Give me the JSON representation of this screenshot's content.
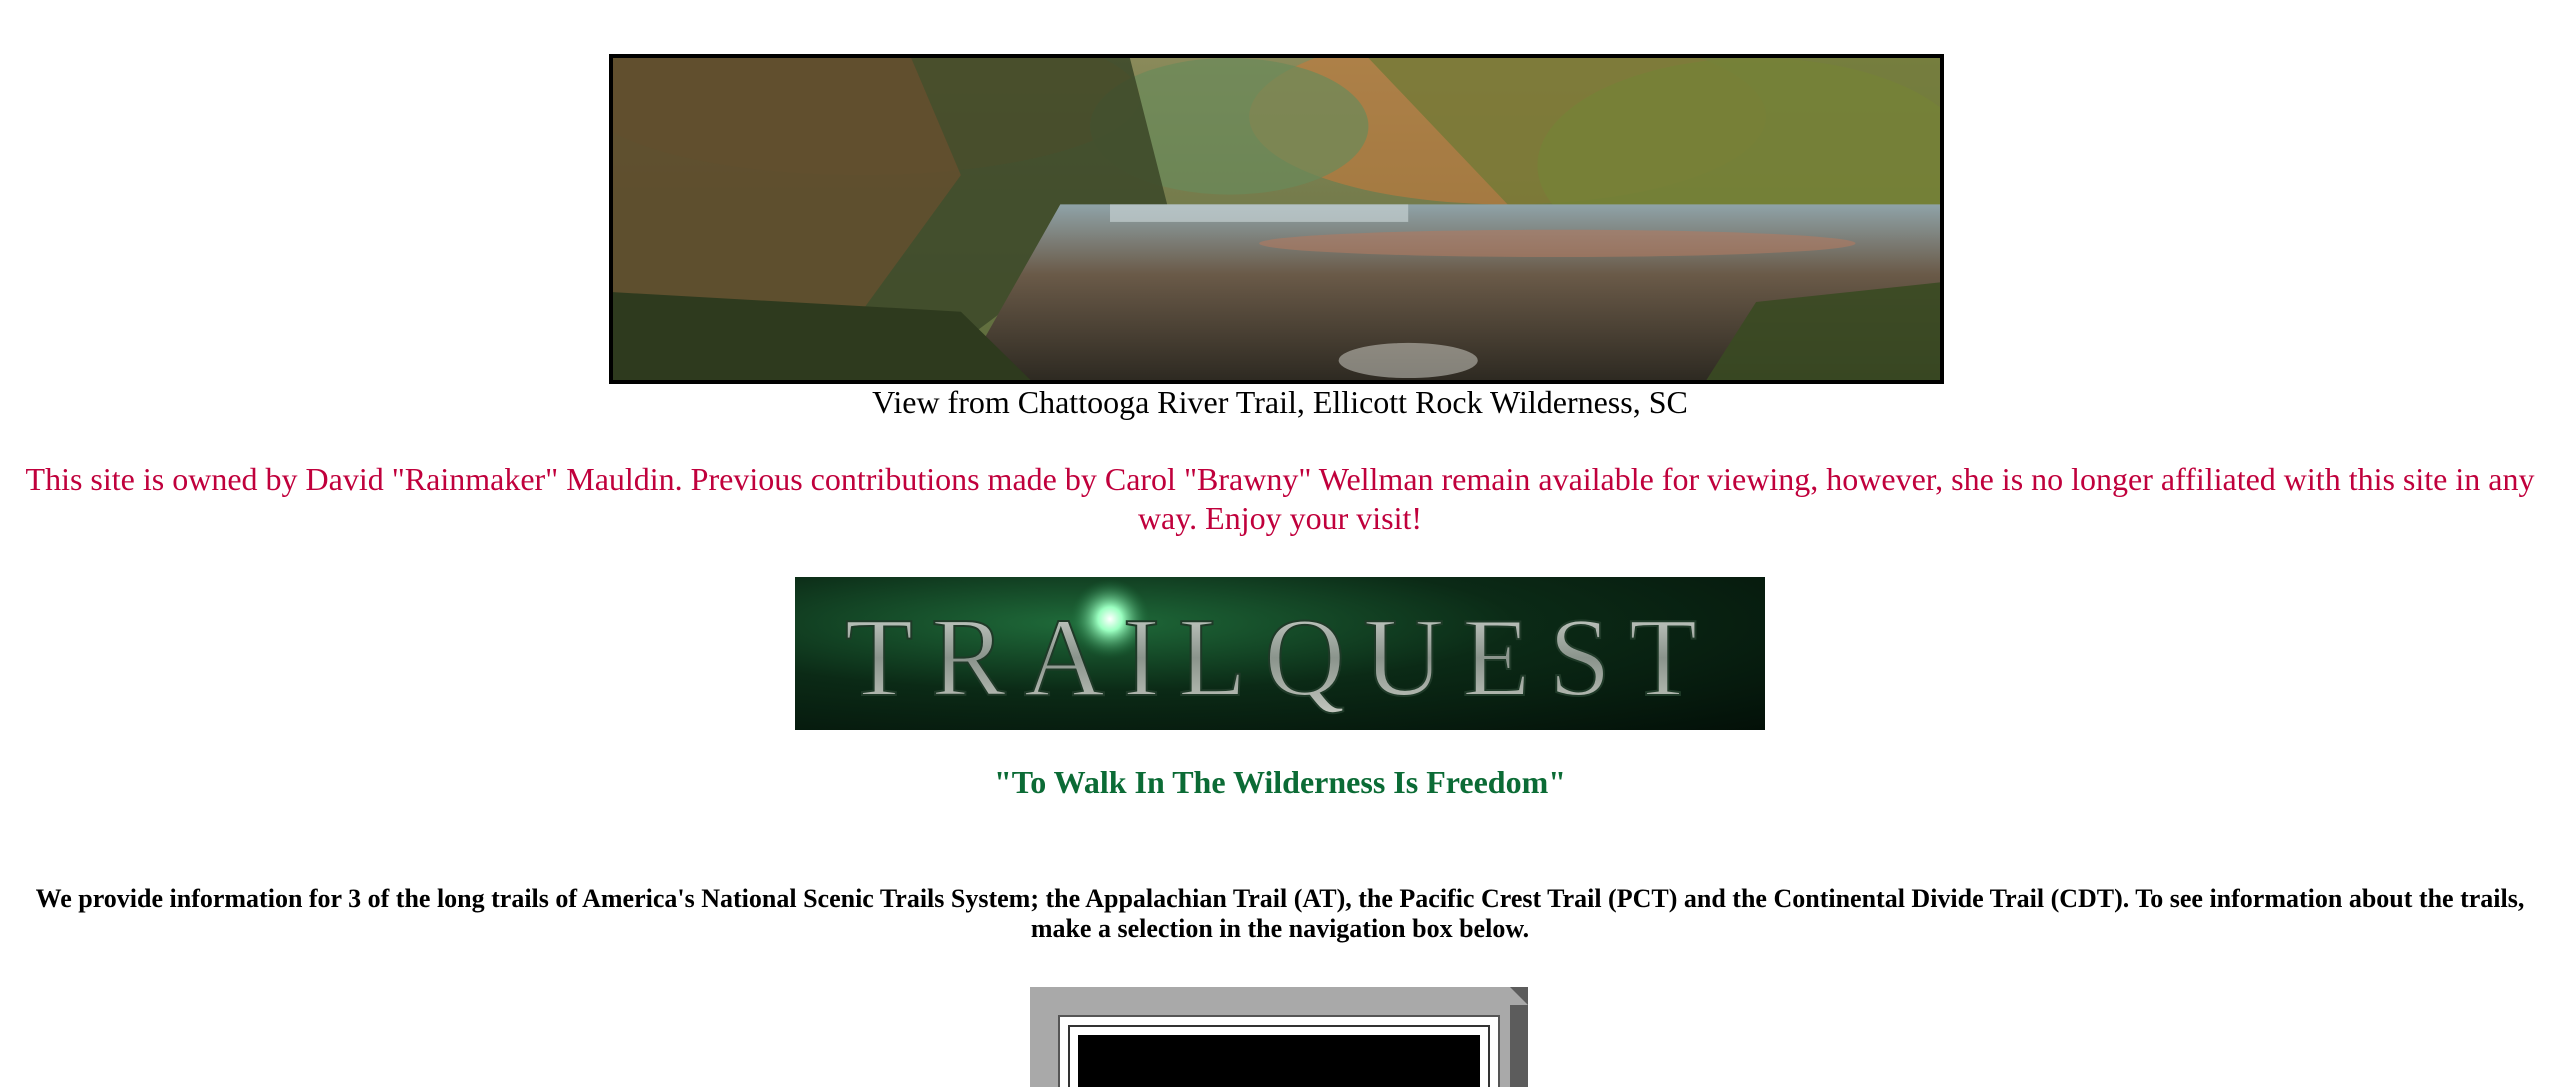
{
  "hero": {
    "caption": "View from Chattooga River Trail, Ellicott Rock Wilderness, SC"
  },
  "notice": {
    "text": "This site is owned by David \"Rainmaker\" Mauldin. Previous contributions made by Carol \"Brawny\" Wellman remain available for viewing, however, she is no longer affiliated with this site in any way. Enjoy your visit!"
  },
  "logo": {
    "text": "TRAILQUEST"
  },
  "motto": "\"To Walk In The Wilderness Is Freedom\"",
  "intro": "We provide information for 3 of the long trails of America's National Scenic Trails System; the Appalachian Trail (AT), the Pacific Crest Trail (PCT) and the Continental Divide Trail (CDT). To see information about the trails, make a selection in the navigation box below.",
  "colors": {
    "notice": "#c0003c",
    "motto": "#0b6b35",
    "text": "#000000",
    "background": "#ffffff"
  }
}
